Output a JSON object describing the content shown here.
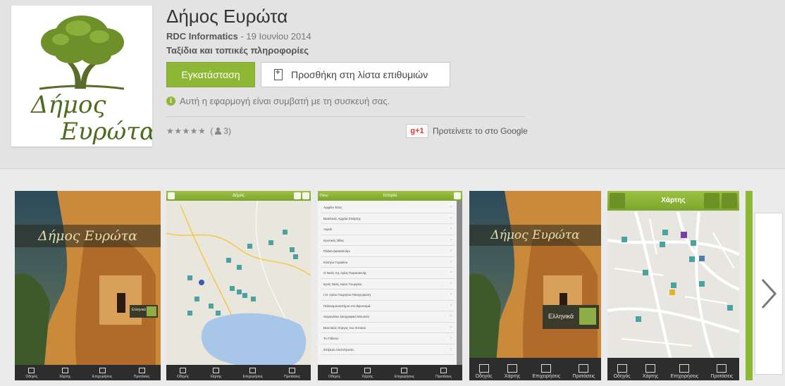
{
  "app": {
    "title": "Δήμος Ευρώτα",
    "developer": "RDC Informatics",
    "date": "- 19 Ιουνίου 2014",
    "category": "Ταξίδια και τοπικές πληροφορίες",
    "icon_text": "Δήμος Ευρώτα"
  },
  "buttons": {
    "install": "Εγκατάσταση",
    "wishlist": "Προσθήκη στη λίστα επιθυμιών"
  },
  "compat": {
    "icon": "info-icon",
    "text": "Αυτή η εφαρμογή είναι συμβατή με τη συσκευή σας."
  },
  "rating": {
    "stars": "★★★★★",
    "count_open": "(",
    "count": "3)",
    "gplus_label": "+1",
    "gplus_text": "Προτείνετε το στο Google"
  },
  "screens": {
    "splash_title": "Δήμος Ευρώτα",
    "splash_lang_small": "Ελληνικά",
    "splash_lang_large": "Ελληνικά",
    "map_header_small": "Δήμος",
    "list_header": "Ιστορία",
    "list_back": "Πίσω",
    "map_header_large": "Χάρτης",
    "list_items": [
      "Αρχαίοι Έλος",
      "Βασιλικός Αρχαία Σπάρτης",
      "Αιγιαλ",
      "Κρυτικός λίθος",
      "Πλάκα Δασκαλούρι",
      "Κάστρο Γερακίου",
      "Ο Ναός της Αγίας Παρασκευής",
      "Ιερός Ναός Αγίου Γεωργίου",
      "Ι.Ν. Αγίου Γεωργίου Πανηγυριώτη",
      "Παλαιομοναστήριο στο Βρονταμά",
      "Χαγιανίτικο λαογραφικό Μουσείο",
      "Βενετικός πύργος του Ιππικού",
      "Το Γύθειου",
      "Σπήλαιο Αλεπότρυπα"
    ],
    "tabs_small": [
      "Οδηγός",
      "Χάρτης",
      "Επιχειρήσεις",
      "Προτάσεις"
    ],
    "tabs_large": [
      "Οδηγός",
      "Χάρτης",
      "Επιχειρήσεις",
      "Προτάσεις"
    ]
  },
  "colors": {
    "accent_green": "#8fb736",
    "header_bg": "#e3e3e3",
    "page_bg": "#ebebeb"
  }
}
